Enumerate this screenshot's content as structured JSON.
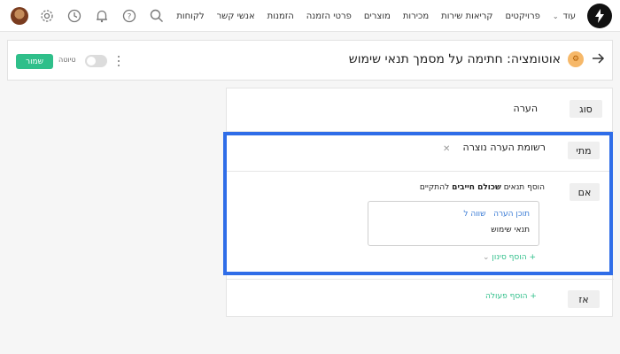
{
  "nav": {
    "items": [
      "לקוחות",
      "אנשי קשר",
      "הזמנות",
      "פרטי הזמנה",
      "מוצרים",
      "מכירות",
      "קריאות שירות",
      "פרויקטים"
    ],
    "more_label": "עוד"
  },
  "icons": [
    "search-icon",
    "help-icon",
    "bell-icon",
    "clock-icon",
    "gear-icon",
    "avatar"
  ],
  "header": {
    "title": "אוטומציה: חתימה על מסמך תנאי שימוש",
    "save_label": "שמור",
    "draft_label": "טיוטה",
    "draft_toggle_on": false
  },
  "sections": {
    "type_tag": "סוג",
    "type_value": "הערה",
    "when_tag": "מתי",
    "when_value": "רשומת הערה נוצרה",
    "if_tag": "אם",
    "if_prefix": "הוסף תנאים",
    "if_bold": "שכולם חייבים",
    "if_suffix": "להתקיים",
    "condition_field": "תוכן הערה",
    "condition_operator": "שווה ל",
    "condition_value": "תנאי שימוש",
    "add_filter": "הוסף סינון",
    "then_tag": "אז",
    "add_action": "הוסף פעולה"
  },
  "colors": {
    "accent_green": "#2fbf8a",
    "highlight_blue": "#2f6de8",
    "link_blue": "#3a7bd5"
  }
}
